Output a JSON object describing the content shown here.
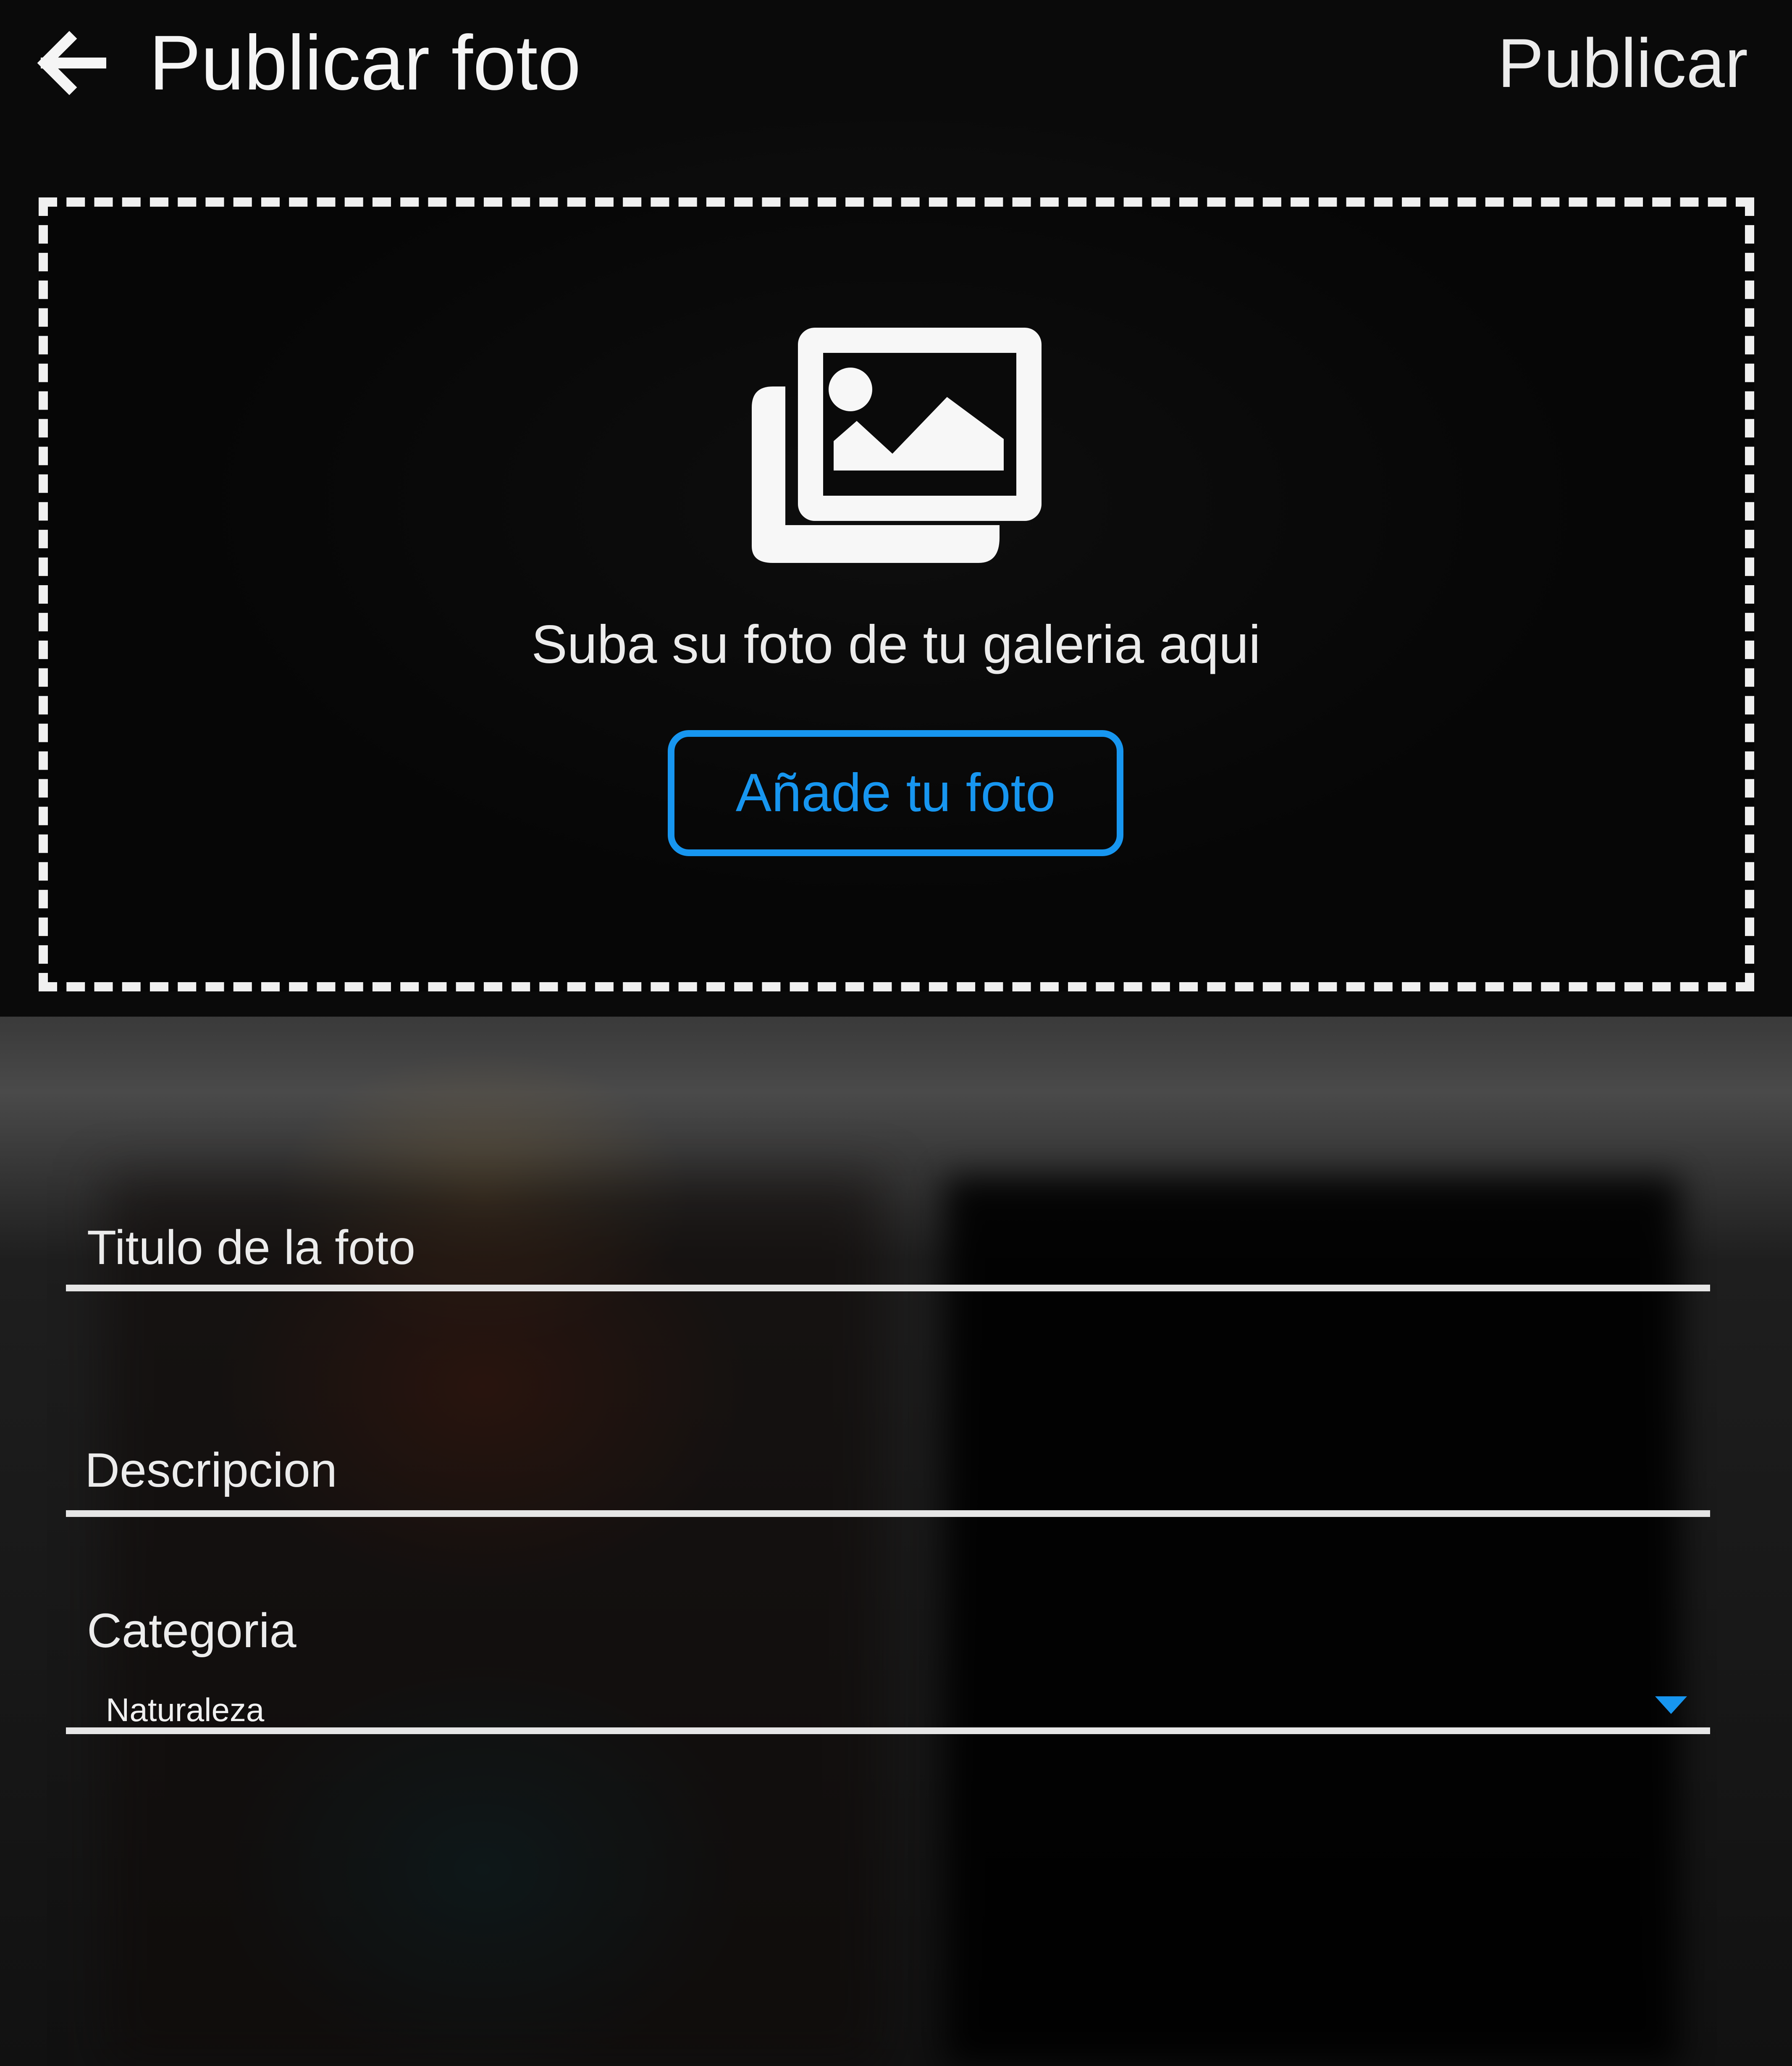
{
  "header": {
    "back_icon": "arrow-left-icon",
    "title": "Publicar foto",
    "publish_label": "Publicar"
  },
  "upload": {
    "icon": "image-gallery-icon",
    "prompt": "Suba su foto de tu galeria aqui",
    "button_label": "Añade tu foto"
  },
  "form": {
    "title_label": "Titulo de la foto",
    "description_label": "Descripcion",
    "category_label": "Categoria",
    "category_value": "Naturaleza",
    "dropdown_icon": "caret-down-icon"
  },
  "colors": {
    "accent": "#1796f0",
    "text": "#f2f2f2",
    "background": "#0d0d0d"
  }
}
